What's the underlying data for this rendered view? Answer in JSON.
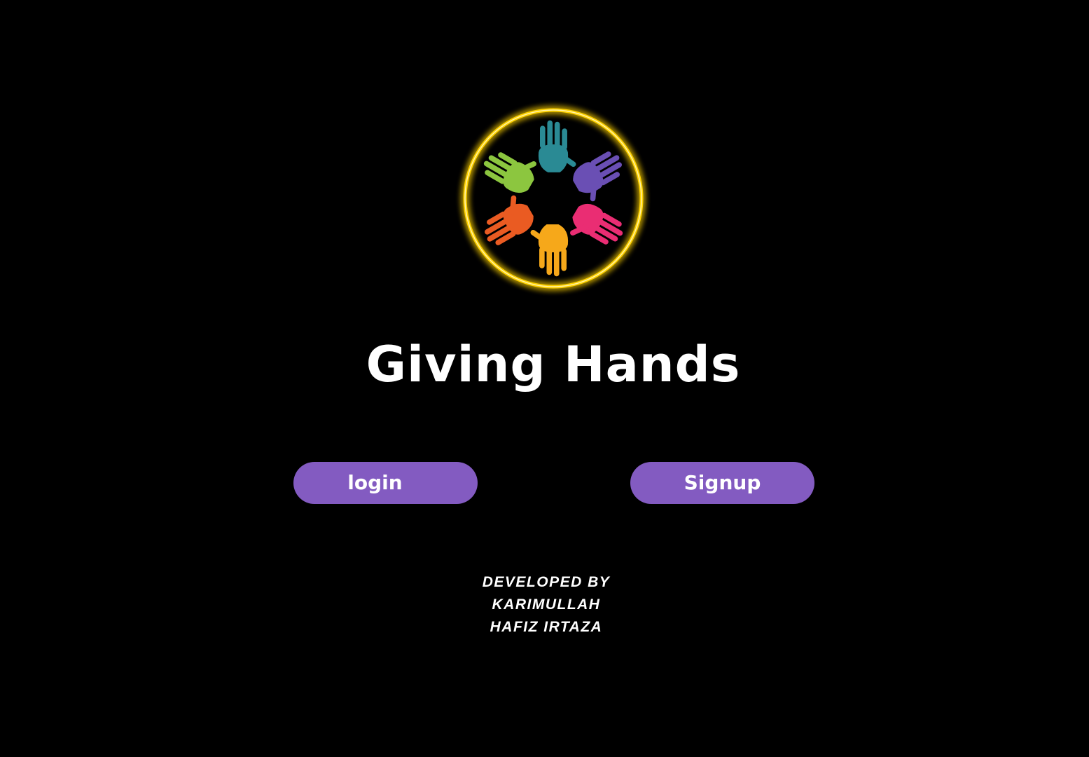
{
  "app": {
    "title": "Giving Hands"
  },
  "logo": {
    "icon": "hands-circle-logo-icon",
    "ring_color": "#ffd200",
    "hand_colors": [
      "#2a8a94",
      "#6a4fb4",
      "#ea2d73",
      "#f6a81a",
      "#ea5b22",
      "#8cc63f"
    ]
  },
  "actions": {
    "login_label": "login",
    "signup_label": "Signup",
    "button_color": "#835bc1"
  },
  "credits": {
    "heading": "DEVELOPED BY",
    "developers": [
      "KARIMULLAH",
      "HAFIZ IRTAZA"
    ]
  }
}
